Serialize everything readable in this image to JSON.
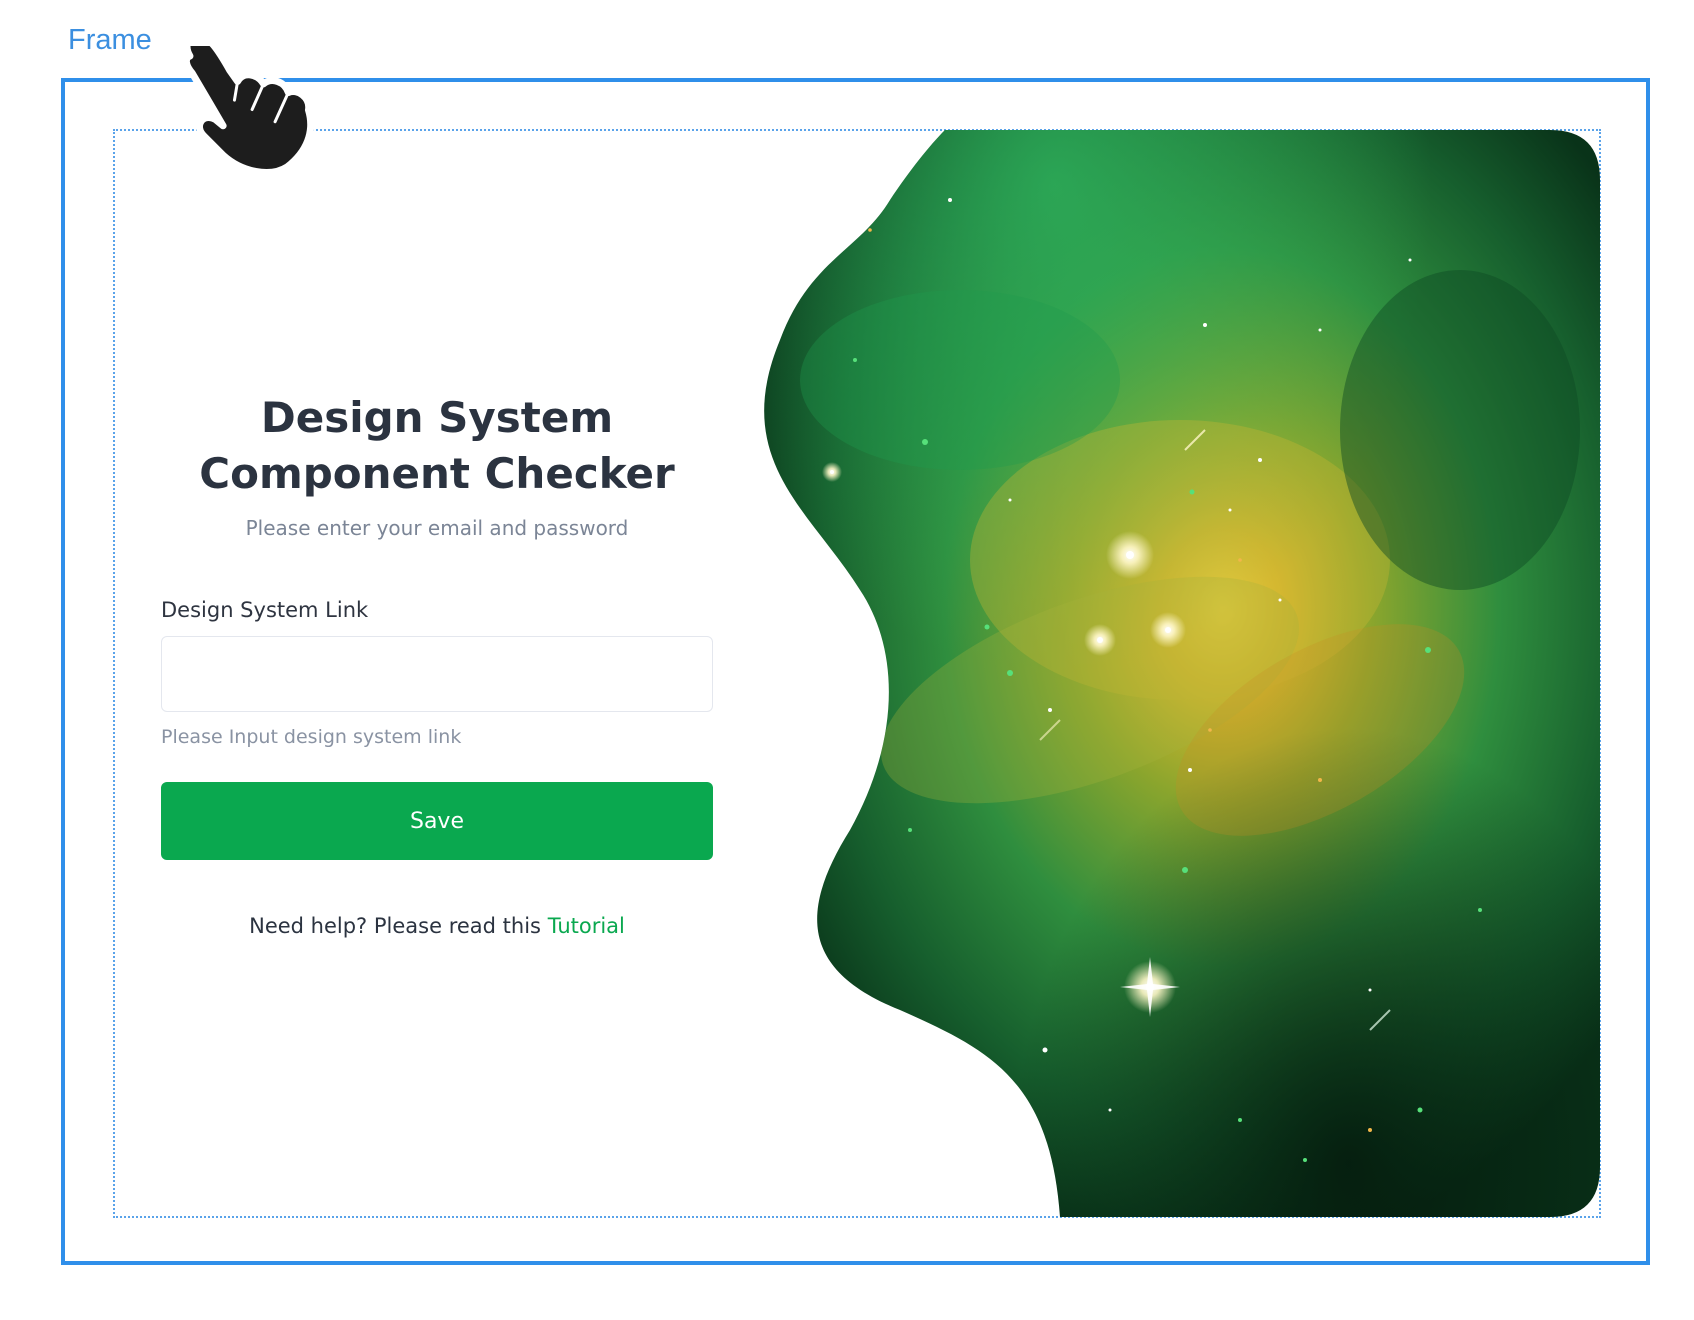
{
  "frame": {
    "label": "Frame"
  },
  "login": {
    "title_line1": "Design System",
    "title_line2": "Component Checker",
    "subtitle": "Please enter your email and password",
    "field_label": "Design System Link",
    "field_value": "",
    "field_placeholder": "",
    "helper_text": "Please Input design system link",
    "save_label": "Save",
    "help_text": "Need help? Please read this",
    "help_link": "Tutorial"
  },
  "icons": {
    "cursor": "hand-pointer-icon"
  },
  "colors": {
    "accent": "#0aa84f",
    "frame_border": "#2f8fea",
    "title": "#2b3340",
    "muted": "#7b8596",
    "galaxy_dark": "#0c3a20",
    "galaxy_mid": "#1c8a45",
    "galaxy_glow": "#e9c83a"
  }
}
